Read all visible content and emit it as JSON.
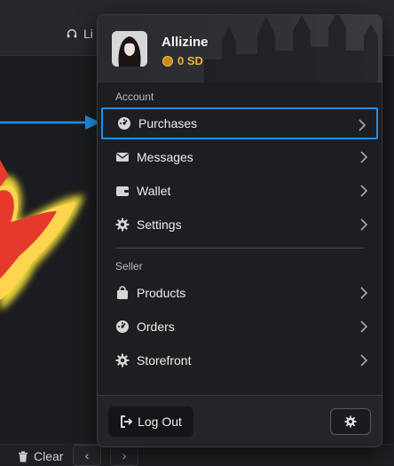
{
  "topbar": {
    "live_label": "Li"
  },
  "bottombar": {
    "clear_label": "Clear",
    "prev_glyph": "‹",
    "next_glyph": "›"
  },
  "user": {
    "name": "Allizine",
    "balance": "0 SD"
  },
  "account": {
    "label": "Account",
    "items": [
      {
        "label": "Purchases",
        "icon": "gauge-icon"
      },
      {
        "label": "Messages",
        "icon": "envelope-icon"
      },
      {
        "label": "Wallet",
        "icon": "wallet-icon"
      },
      {
        "label": "Settings",
        "icon": "gear-icon"
      }
    ]
  },
  "seller": {
    "label": "Seller",
    "items": [
      {
        "label": "Products",
        "icon": "bag-icon"
      },
      {
        "label": "Orders",
        "icon": "gauge-icon"
      },
      {
        "label": "Storefront",
        "icon": "gear-icon"
      }
    ]
  },
  "footer": {
    "logout_label": "Log Out"
  },
  "colors": {
    "accent_highlight": "#1f8fe6",
    "balance": "#f2b233"
  }
}
